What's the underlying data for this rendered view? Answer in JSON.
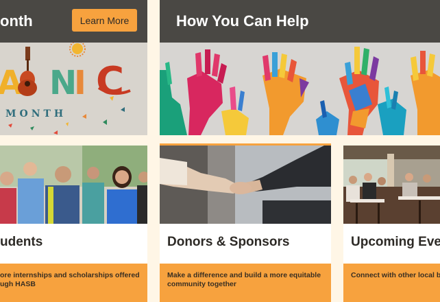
{
  "hero_left": {
    "title": "onth",
    "button_label": "Learn More"
  },
  "hero_right": {
    "title": "How You Can Help"
  },
  "banner_art": {
    "letters": [
      "A",
      "N",
      "I",
      "C"
    ],
    "subtitle": "MONTH"
  },
  "cards": [
    {
      "title": "udents",
      "desc_line1": "ore internships and scholarships offered",
      "desc_line2": "ugh HASB"
    },
    {
      "title": "Donors & Sponsors",
      "desc_line1": "Make a difference and build a more equitable",
      "desc_line2": "community together"
    },
    {
      "title": "Upcoming Eve",
      "desc_line1": "Connect with other local bu",
      "desc_line2": ""
    }
  ],
  "colors": {
    "header_bg": "#4a4844",
    "accent_orange": "#f7a23e",
    "page_bg": "#fff6e6"
  }
}
